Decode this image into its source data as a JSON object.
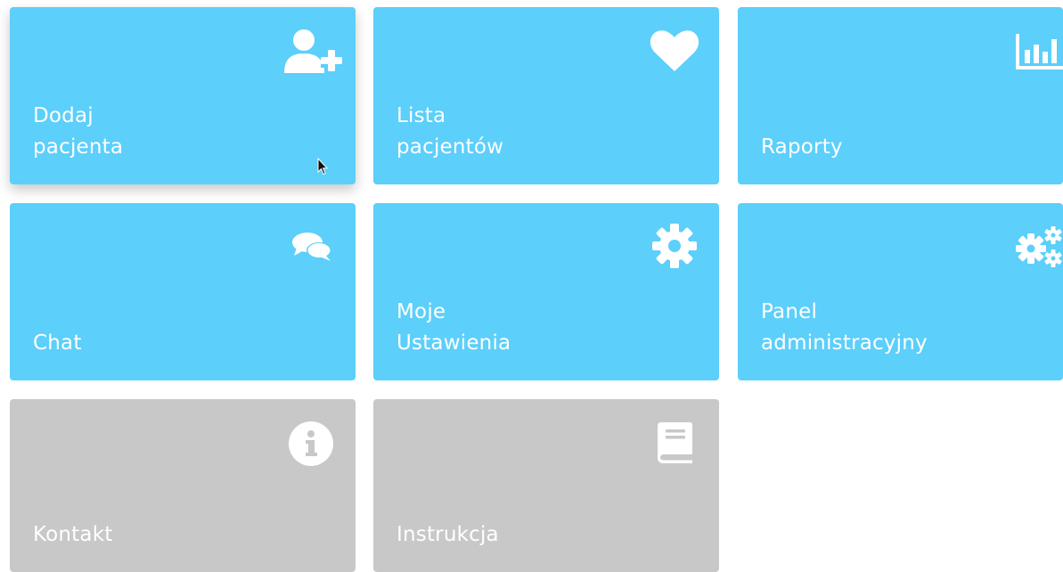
{
  "colors": {
    "tile_active": "#5ccffb",
    "tile_disabled": "#c8c8c8",
    "text": "#ffffff"
  },
  "tiles": [
    {
      "lines": [
        "Dodaj",
        "pacjenta"
      ],
      "icon": "add-user-icon",
      "state": "active"
    },
    {
      "lines": [
        "Lista",
        "pacjentów"
      ],
      "icon": "heart-icon",
      "state": "active"
    },
    {
      "lines": [
        "Raporty"
      ],
      "icon": "bar-chart-icon",
      "state": "active"
    },
    {
      "lines": [
        "Chat"
      ],
      "icon": "chat-bubbles-icon",
      "state": "active"
    },
    {
      "lines": [
        "Moje",
        "Ustawienia"
      ],
      "icon": "gear-icon",
      "state": "active"
    },
    {
      "lines": [
        "Panel",
        "administracyjny"
      ],
      "icon": "gears-icon",
      "state": "active"
    },
    {
      "lines": [
        "Kontakt"
      ],
      "icon": "info-icon",
      "state": "disabled"
    },
    {
      "lines": [
        "Instrukcja"
      ],
      "icon": "book-icon",
      "state": "disabled"
    }
  ]
}
